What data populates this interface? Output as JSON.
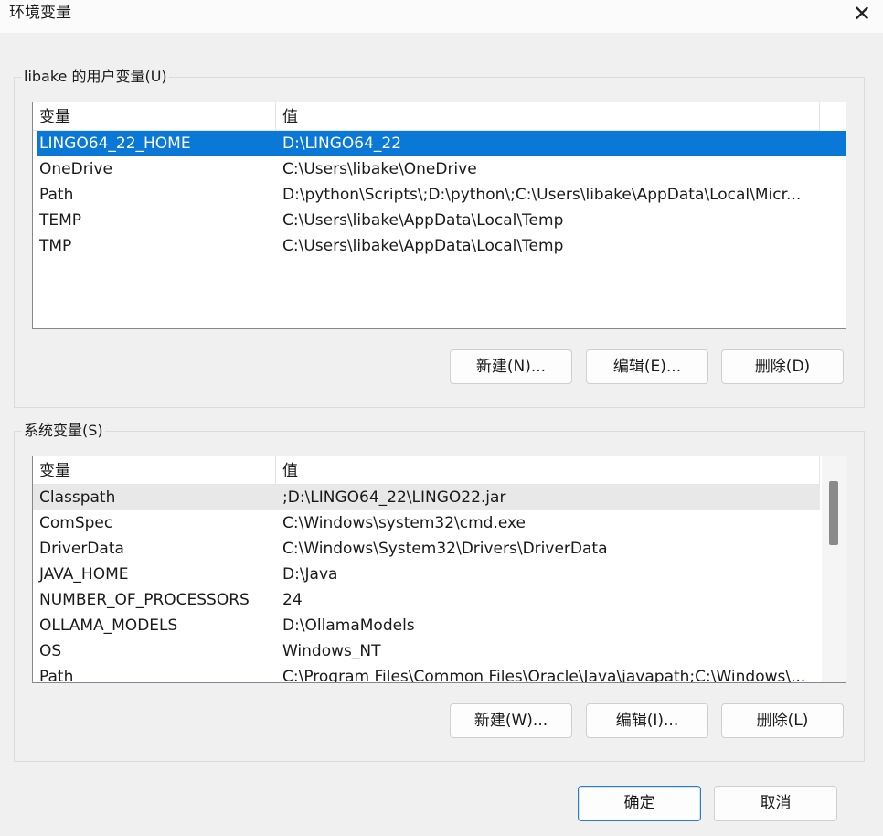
{
  "window": {
    "title": "环境变量",
    "close_label": "✕"
  },
  "user_vars": {
    "group_label": "libake 的用户变量(U)",
    "columns": [
      "变量",
      "值"
    ],
    "rows": [
      {
        "name": "LINGO64_22_HOME",
        "value": "D:\\LINGO64_22",
        "selected": true
      },
      {
        "name": "OneDrive",
        "value": "C:\\Users\\libake\\OneDrive"
      },
      {
        "name": "Path",
        "value": "D:\\python\\Scripts\\;D:\\python\\;C:\\Users\\libake\\AppData\\Local\\Micr..."
      },
      {
        "name": "TEMP",
        "value": "C:\\Users\\libake\\AppData\\Local\\Temp"
      },
      {
        "name": "TMP",
        "value": "C:\\Users\\libake\\AppData\\Local\\Temp"
      }
    ],
    "buttons": {
      "new": "新建(N)...",
      "edit": "编辑(E)...",
      "delete": "删除(D)"
    }
  },
  "system_vars": {
    "group_label": "系统变量(S)",
    "columns": [
      "变量",
      "值"
    ],
    "rows": [
      {
        "name": "Classpath",
        "value": ";D:\\LINGO64_22\\LINGO22.jar",
        "hover": true
      },
      {
        "name": "ComSpec",
        "value": "C:\\Windows\\system32\\cmd.exe"
      },
      {
        "name": "DriverData",
        "value": "C:\\Windows\\System32\\Drivers\\DriverData"
      },
      {
        "name": "JAVA_HOME",
        "value": "D:\\Java"
      },
      {
        "name": "NUMBER_OF_PROCESSORS",
        "value": "24"
      },
      {
        "name": "OLLAMA_MODELS",
        "value": "D:\\OllamaModels"
      },
      {
        "name": "OS",
        "value": "Windows_NT"
      },
      {
        "name": "Path",
        "value": "C:\\Program Files\\Common Files\\Oracle\\Java\\javapath;C:\\Windows\\..."
      }
    ],
    "buttons": {
      "new": "新建(W)...",
      "edit": "编辑(I)...",
      "delete": "删除(L)"
    }
  },
  "footer": {
    "ok": "确定",
    "cancel": "取消"
  },
  "colors": {
    "selection": "#0a78d7",
    "dialog_bg": "#f0f0f0",
    "primary_border": "#2b7cd3"
  },
  "icons": {
    "close": "close-icon"
  }
}
